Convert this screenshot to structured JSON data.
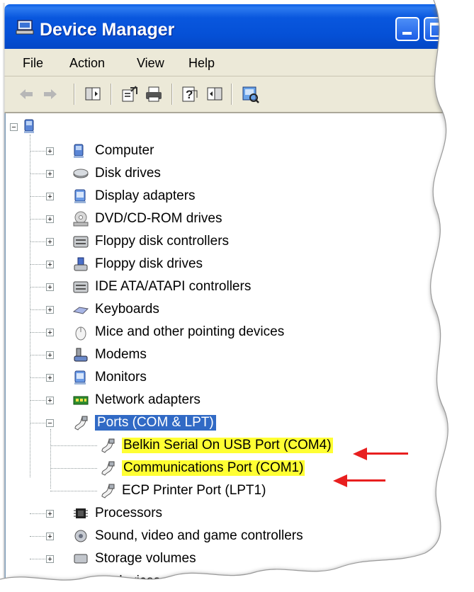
{
  "window": {
    "title": "Device Manager"
  },
  "menu": {
    "file": "File",
    "action": "Action",
    "view": "View",
    "help": "Help"
  },
  "tree": {
    "root_expander": "−",
    "items": [
      {
        "label": "Computer",
        "expander": "+",
        "icon": "computer-icon"
      },
      {
        "label": "Disk drives",
        "expander": "+",
        "icon": "disk-drive-icon"
      },
      {
        "label": "Display adapters",
        "expander": "+",
        "icon": "display-adapter-icon"
      },
      {
        "label": "DVD/CD-ROM drives",
        "expander": "+",
        "icon": "dvd-drive-icon"
      },
      {
        "label": "Floppy disk controllers",
        "expander": "+",
        "icon": "controller-icon"
      },
      {
        "label": "Floppy disk drives",
        "expander": "+",
        "icon": "floppy-drive-icon"
      },
      {
        "label": "IDE ATA/ATAPI controllers",
        "expander": "+",
        "icon": "ide-controller-icon"
      },
      {
        "label": "Keyboards",
        "expander": "+",
        "icon": "keyboard-icon"
      },
      {
        "label": "Mice and other pointing devices",
        "expander": "+",
        "icon": "mouse-icon"
      },
      {
        "label": "Modems",
        "expander": "+",
        "icon": "modem-icon"
      },
      {
        "label": "Monitors",
        "expander": "+",
        "icon": "monitor-icon"
      },
      {
        "label": "Network adapters",
        "expander": "+",
        "icon": "network-adapter-icon"
      },
      {
        "label": "Ports (COM & LPT)",
        "expander": "−",
        "icon": "port-icon",
        "selected": true
      },
      {
        "label": "Processors",
        "expander": "+",
        "icon": "processor-icon"
      },
      {
        "label": "Sound, video and game controllers",
        "expander": "+",
        "icon": "sound-icon"
      },
      {
        "label": "Storage volumes",
        "expander": "+",
        "icon": "storage-icon"
      }
    ],
    "ports_children": [
      {
        "label": "Belkin Serial On USB Port (COM4)",
        "highlighted": true,
        "icon": "port-icon"
      },
      {
        "label": "Communications Port (COM1)",
        "highlighted": true,
        "icon": "port-icon"
      },
      {
        "label": "ECP Printer Port (LPT1)",
        "highlighted": false,
        "icon": "port-icon"
      }
    ],
    "partial_last_visible": "devices"
  },
  "colors": {
    "selection": "#316ac5",
    "highlight": "#ffff33",
    "annotation_arrow": "#e81f1f",
    "titlebar": "#0550d6"
  }
}
